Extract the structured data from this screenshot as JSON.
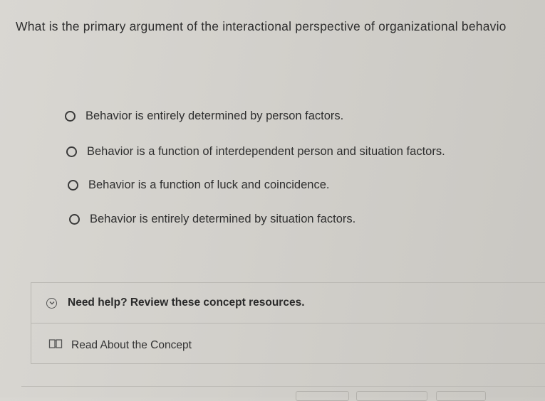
{
  "question": {
    "text": "What is the primary argument of the interactional perspective of organizational behavio"
  },
  "options": [
    {
      "label": "Behavior is entirely determined by person factors."
    },
    {
      "label": "Behavior is a function of interdependent person and situation factors."
    },
    {
      "label": "Behavior is a function of luck and coincidence."
    },
    {
      "label": "Behavior is entirely determined by situation factors."
    }
  ],
  "help": {
    "title": "Need help? Review these concept resources.",
    "icon": "chevron-down-circle-icon",
    "resource": {
      "label": "Read About the Concept",
      "icon": "book-icon"
    }
  }
}
